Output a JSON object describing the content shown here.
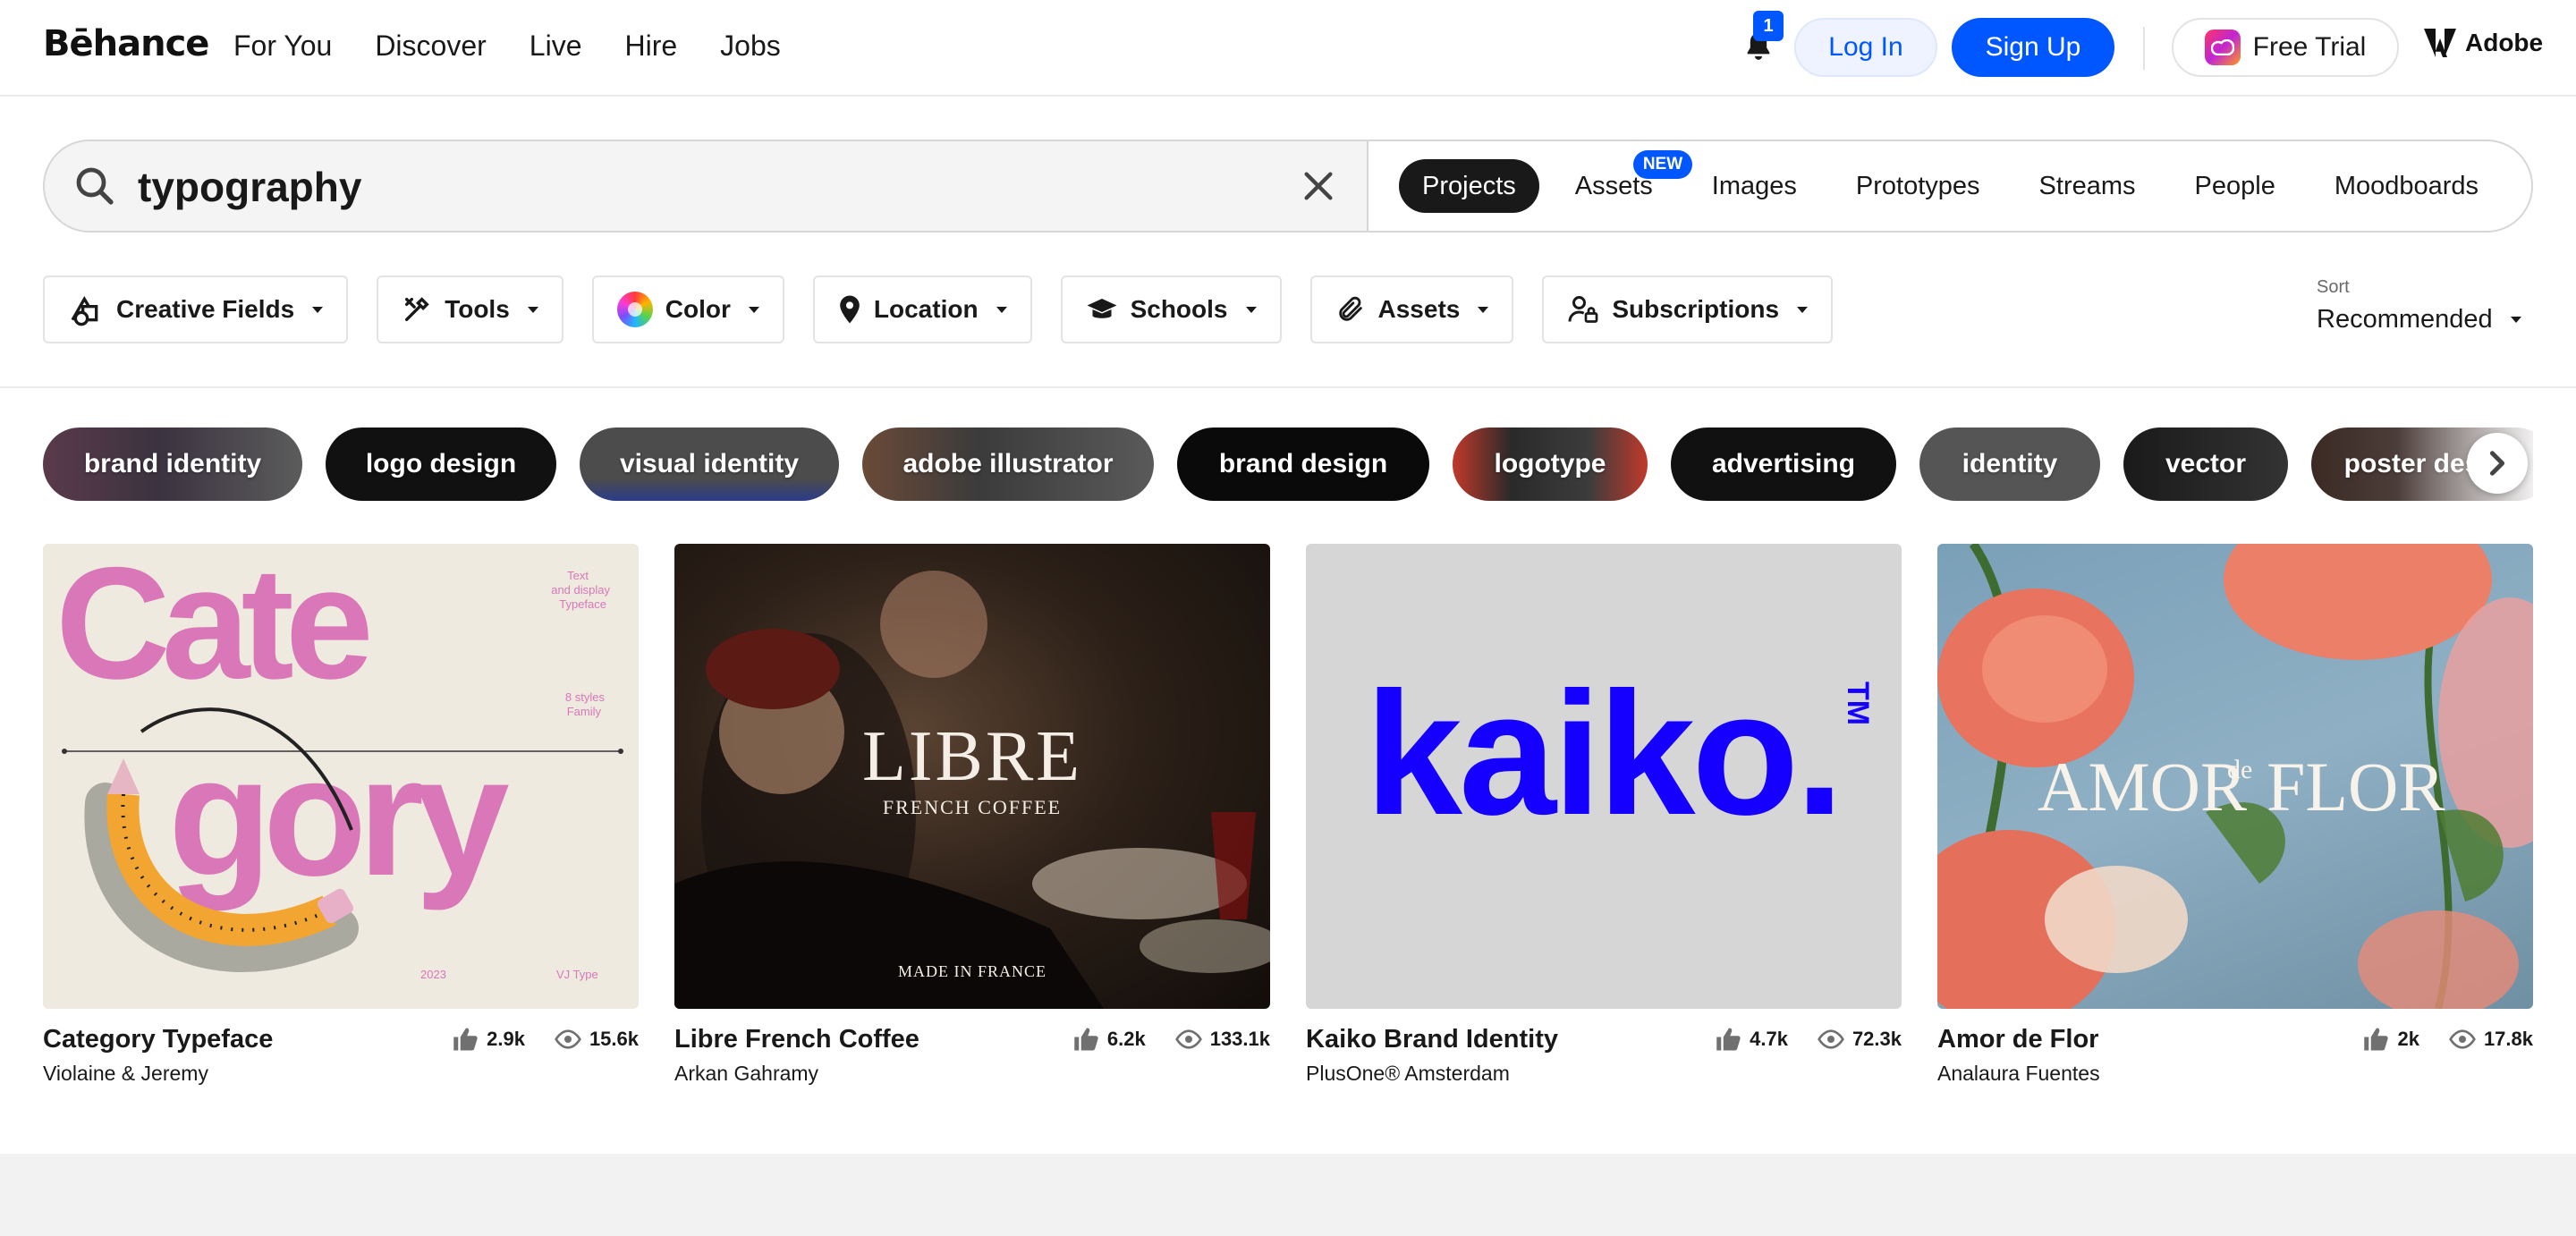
{
  "brand": {
    "logo_text": "Bēhance"
  },
  "nav": {
    "links": [
      "For You",
      "Discover",
      "Live",
      "Hire",
      "Jobs"
    ],
    "notification_count": "1",
    "login_label": "Log In",
    "signup_label": "Sign Up",
    "trial_label": "Free Trial",
    "adobe_label": "Adobe"
  },
  "search": {
    "query": "typography",
    "tabs": [
      "Projects",
      "Assets",
      "Images",
      "Prototypes",
      "Streams",
      "People",
      "Moodboards"
    ],
    "active_tab": "Projects",
    "new_badge": "NEW"
  },
  "filters": {
    "items": [
      "Creative Fields",
      "Tools",
      "Color",
      "Location",
      "Schools",
      "Assets",
      "Subscriptions"
    ],
    "sort_label": "Sort",
    "sort_value": "Recommended"
  },
  "tags": [
    "brand identity",
    "logo design",
    "visual identity",
    "adobe illustrator",
    "brand design",
    "logotype",
    "advertising",
    "identity",
    "vector",
    "poster design"
  ],
  "cards": [
    {
      "title": "Category Typeface",
      "owner": "Violaine & Jeremy",
      "likes": "2.9k",
      "views": "15.6k",
      "art": {
        "word1": "Cate",
        "word2": "gory",
        "side1": "Text and display Typeface",
        "side2": "8 styles Family",
        "year": "2023",
        "foundry": "VJ Type"
      }
    },
    {
      "title": "Libre French Coffee",
      "owner": "Arkan Gahramy",
      "likes": "6.2k",
      "views": "133.1k",
      "art": {
        "mark": "LIBRE",
        "sub": "FRENCH COFFEE",
        "foot": "MADE IN FRANCE"
      }
    },
    {
      "title": "Kaiko Brand Identity",
      "owner": "PlusOne® Amsterdam",
      "likes": "4.7k",
      "views": "72.3k",
      "art": {
        "mark": "kaiko.",
        "tm": "TM"
      }
    },
    {
      "title": "Amor de Flor",
      "owner": "Analaura Fuentes",
      "likes": "2k",
      "views": "17.8k",
      "art": {
        "mark_left": "AMOR",
        "mark_mid": "de",
        "mark_right": "FLOR"
      }
    }
  ],
  "colors": {
    "accent": "#0057ff",
    "dark": "#191919",
    "kaiko_blue": "#1500ff",
    "category_pink": "#d977b9"
  }
}
